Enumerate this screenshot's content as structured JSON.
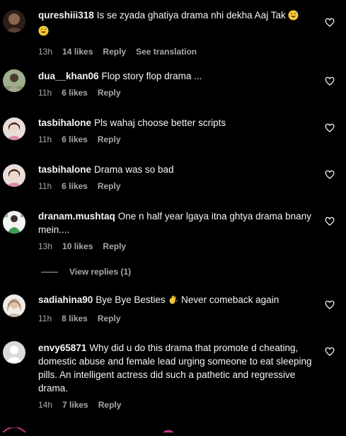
{
  "comments": [
    {
      "username": "qureshiii318",
      "text": "Is se zyada ghatiya drama nhi dekha Aaj Tak",
      "emoji": "grinning-sweat-face",
      "emoji_after_wrap": "grinning-sweat-face",
      "time": "13h",
      "likes": "14 likes",
      "reply": "Reply",
      "translate": "See translation",
      "avatar_color": "#6b4a3a"
    },
    {
      "username": "dua__khan06",
      "text": "Flop story flop drama ...",
      "time": "11h",
      "likes": "6 likes",
      "reply": "Reply",
      "avatar_color": "#7a8a6a"
    },
    {
      "username": "tasbihalone",
      "text": "Pls wahaj choose better scripts",
      "time": "11h",
      "likes": "6 likes",
      "reply": "Reply",
      "avatar_color": "#d9c8c2"
    },
    {
      "username": "tasbihalone",
      "text": "Drama was so bad",
      "time": "11h",
      "likes": "6 likes",
      "reply": "Reply",
      "avatar_color": "#d9c8c2"
    },
    {
      "username": "dranam.mushtaq",
      "text": "One n half year lgaya itna ghtya drama bnany mein....",
      "time": "13h",
      "likes": "10 likes",
      "reply": "Reply",
      "avatar_color": "#5c8a5c"
    },
    {
      "username": "sadiahina90",
      "text": "Bye Bye Besties",
      "emoji": "waving-hand",
      "text_after_emoji": "Never comeback again",
      "time": "11h",
      "likes": "8 likes",
      "reply": "Reply",
      "avatar_color": "#c9b8a8"
    },
    {
      "username": "envy65871",
      "text": "Why did u do this drama that promote d cheating, domestic abuse and female lead urging someone to eat sleeping pills. An intelligent actress did such a pathetic and regressive drama.",
      "time": "14h",
      "likes": "7 likes",
      "reply": "Reply",
      "avatar_color": "#dbdbdb"
    }
  ],
  "view_replies": "View replies (1)",
  "colors": {
    "background": "#000000",
    "text": "#f5f5f5",
    "secondary": "#a8a8a8"
  },
  "icons": {
    "like": "heart-outline-icon"
  }
}
